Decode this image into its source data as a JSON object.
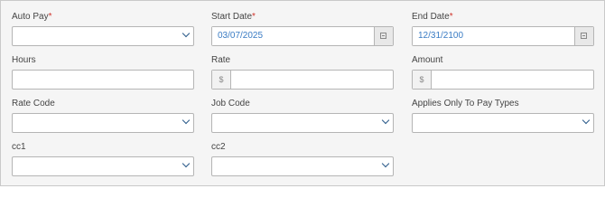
{
  "fields": {
    "auto_pay": {
      "label": "Auto Pay",
      "required_mark": "*",
      "value": ""
    },
    "start_date": {
      "label": "Start Date",
      "required_mark": "*",
      "value": "03/07/2025"
    },
    "end_date": {
      "label": "End Date",
      "required_mark": "*",
      "value": "12/31/2100"
    },
    "hours": {
      "label": "Hours",
      "value": ""
    },
    "rate": {
      "label": "Rate",
      "prefix": "$",
      "value": ""
    },
    "amount": {
      "label": "Amount",
      "prefix": "$",
      "value": ""
    },
    "rate_code": {
      "label": "Rate Code",
      "value": ""
    },
    "job_code": {
      "label": "Job Code",
      "value": ""
    },
    "applies_only_to_pay_types": {
      "label": "Applies Only To Pay Types",
      "value": ""
    },
    "cc1": {
      "label": "cc1",
      "value": ""
    },
    "cc2": {
      "label": "cc2",
      "value": ""
    }
  },
  "icons": {
    "dropdown": "chevron-down-icon",
    "calendar": "calendar-icon"
  },
  "colors": {
    "required": "#d0342c",
    "date_text": "#3a7cc4",
    "chevron": "#2a5a8a",
    "panel_bg": "#f5f5f5"
  }
}
